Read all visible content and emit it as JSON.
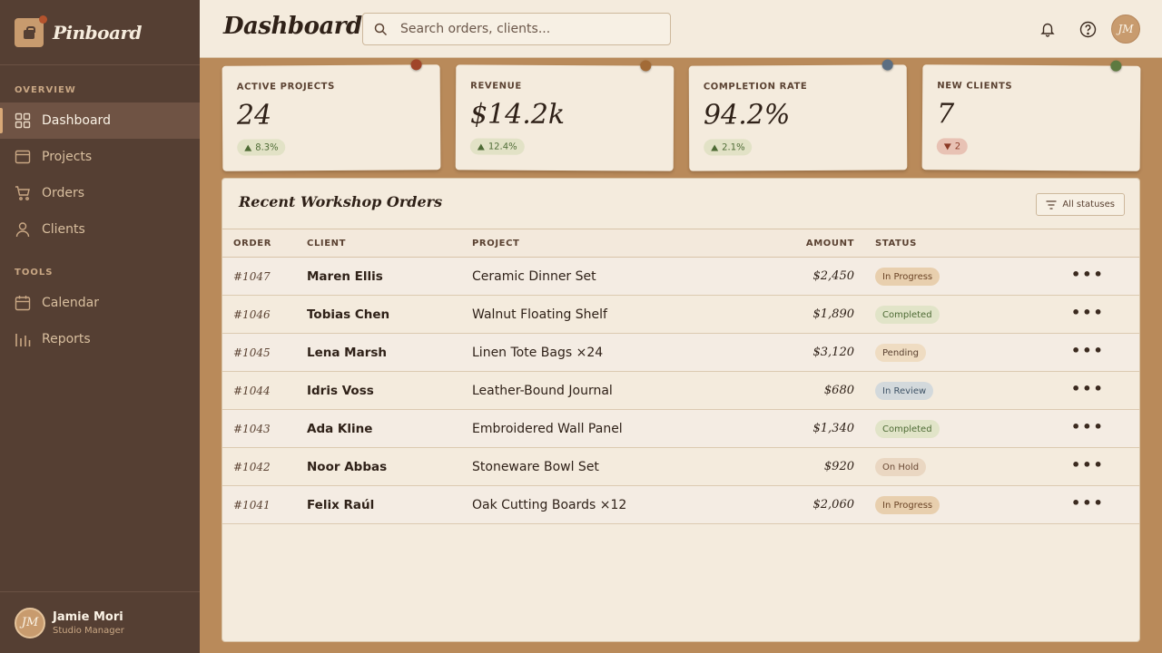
{
  "app": {
    "name": "Pinboard"
  },
  "sidebar": {
    "sections": [
      {
        "label": "OVERVIEW"
      },
      {
        "label": "TOOLS"
      }
    ],
    "items": [
      {
        "label": "Dashboard",
        "icon": "grid-icon"
      },
      {
        "label": "Projects",
        "icon": "browser-window-icon"
      },
      {
        "label": "Orders",
        "icon": "cart-icon"
      },
      {
        "label": "Clients",
        "icon": "user-icon"
      },
      {
        "label": "Calendar",
        "icon": "calendar-icon"
      },
      {
        "label": "Reports",
        "icon": "bar-chart-icon"
      }
    ],
    "active": "Dashboard",
    "user": {
      "initials": "JM",
      "name": "Jamie Mori",
      "role": "Studio Manager"
    }
  },
  "header": {
    "title": "Dashboard",
    "search_placeholder": "Search orders, clients...",
    "avatar_initials": "JM"
  },
  "stats": [
    {
      "label": "ACTIVE PROJECTS",
      "value": "24",
      "change": "8.3%",
      "direction": "up",
      "pin_color": "#a0452a"
    },
    {
      "label": "REVENUE",
      "value": "$14.2k",
      "change": "12.4%",
      "direction": "up",
      "pin_color": "#a26a36"
    },
    {
      "label": "COMPLETION RATE",
      "value": "94.2%",
      "change": "2.1%",
      "direction": "up",
      "pin_color": "#5b6e82"
    },
    {
      "label": "NEW CLIENTS",
      "value": "7",
      "change": "2",
      "direction": "down",
      "pin_color": "#5e7a40"
    }
  ],
  "orders": {
    "title": "Recent Workshop Orders",
    "filter_label": "All statuses",
    "columns": [
      "ORDER",
      "CLIENT",
      "PROJECT",
      "AMOUNT",
      "STATUS"
    ],
    "rows": [
      {
        "order": "#1047",
        "client": "Maren Ellis",
        "project": "Ceramic Dinner Set",
        "amount": "$2,450",
        "status": "In Progress"
      },
      {
        "order": "#1046",
        "client": "Tobias Chen",
        "project": "Walnut Floating Shelf",
        "amount": "$1,890",
        "status": "Completed"
      },
      {
        "order": "#1045",
        "client": "Lena Marsh",
        "project": "Linen Tote Bags ×24",
        "amount": "$3,120",
        "status": "Pending"
      },
      {
        "order": "#1044",
        "client": "Idris Voss",
        "project": "Leather-Bound Journal",
        "amount": "$680",
        "status": "In Review"
      },
      {
        "order": "#1043",
        "client": "Ada Kline",
        "project": "Embroidered Wall Panel",
        "amount": "$1,340",
        "status": "Completed"
      },
      {
        "order": "#1042",
        "client": "Noor Abbas",
        "project": "Stoneware Bowl Set",
        "amount": "$920",
        "status": "On Hold"
      },
      {
        "order": "#1041",
        "client": "Felix Raúl",
        "project": "Oak Cutting Boards ×12",
        "amount": "$2,060",
        "status": "In Progress"
      }
    ],
    "more_glyph": "•••",
    "status_colors": {
      "In Progress": {
        "bg": "#e8cfae",
        "fg": "#6b4426"
      },
      "Completed": {
        "bg": "#e1e4c8",
        "fg": "#4d6a34"
      },
      "Pending": {
        "bg": "#efdcc2",
        "fg": "#5a4131"
      },
      "In Review": {
        "bg": "#d3d9dc",
        "fg": "#3f5366"
      },
      "On Hold": {
        "bg": "#ead7c2",
        "fg": "#6b4a35"
      }
    }
  }
}
